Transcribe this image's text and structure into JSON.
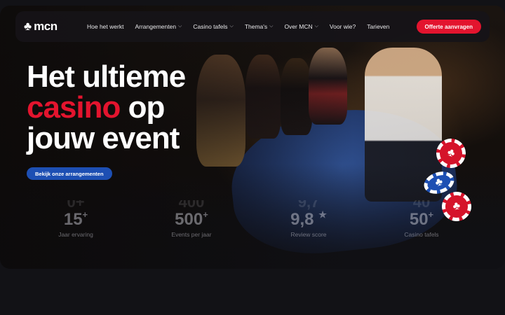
{
  "brand": {
    "logo_text": "mcn",
    "logo_icon": "clover-icon"
  },
  "nav": {
    "items": [
      {
        "label": "Hoe het werkt",
        "dropdown": false
      },
      {
        "label": "Arrangementen",
        "dropdown": true
      },
      {
        "label": "Casino tafels",
        "dropdown": true
      },
      {
        "label": "Thema's",
        "dropdown": true
      },
      {
        "label": "Over MCN",
        "dropdown": true
      },
      {
        "label": "Voor wie?",
        "dropdown": false
      },
      {
        "label": "Tarieven",
        "dropdown": false
      }
    ],
    "chevron": "⌵",
    "cta_label": "Offerte aanvragen"
  },
  "hero": {
    "line1": "Het ultieme",
    "line2_red": "casino",
    "line2_rest": " op",
    "line3": "jouw event",
    "button_label": "Bekijk onze arrangementen"
  },
  "stats": [
    {
      "ghost": "0+",
      "value": "15",
      "suffix": "+",
      "label": "Jaar ervaring"
    },
    {
      "ghost": "400",
      "value": "500",
      "suffix": "+",
      "label": "Events per jaar"
    },
    {
      "ghost": "9,7",
      "value": "9,8",
      "suffix": "★",
      "label": "Review score"
    },
    {
      "ghost": "40",
      "value": "50",
      "suffix": "+",
      "label": "Casino tafels"
    }
  ],
  "colors": {
    "accent_red": "#e3142e",
    "accent_blue": "#1d4fb3",
    "background": "#121216"
  }
}
